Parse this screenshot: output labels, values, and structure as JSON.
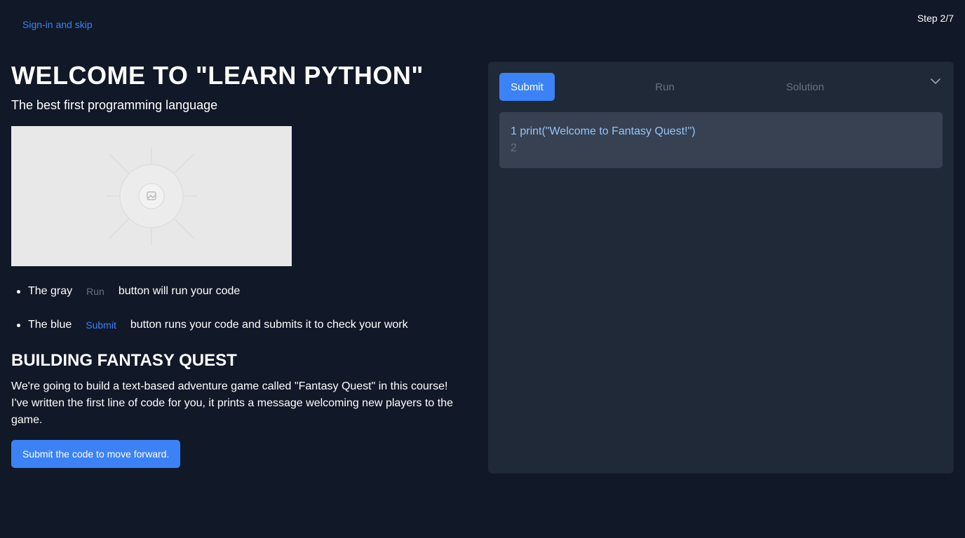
{
  "header": {
    "skip_link": "Sign-in and skip",
    "step": "Step 2/7"
  },
  "lesson": {
    "title": "WELCOME TO \"LEARN PYTHON\"",
    "subtitle": "The best first programming language",
    "bullets": [
      {
        "before": "The gray",
        "chip": "Run",
        "after": "button will run your code"
      },
      {
        "before": "The blue",
        "chip": "Submit",
        "after": "button runs your code and submits it to check your work"
      }
    ],
    "section_title": "BUILDING FANTASY QUEST",
    "paragraph": "We're going to build a text-based adventure game called \"Fantasy Quest\" in this course! I've written the first line of code for you, it prints a message welcoming new players to the game.",
    "cta": "Submit the code to move forward."
  },
  "editor_panel": {
    "submit_label": "Submit",
    "run_label": "Run",
    "solution_label": "Solution",
    "chevron_icon": "chevron-down-icon",
    "code_lines": [
      "1 print(\"Welcome to Fantasy Quest!\")",
      "2"
    ]
  },
  "colors": {
    "background": "#111827",
    "panel": "#1f2937",
    "editor": "#374151",
    "accent": "#3b82f6",
    "muted": "#6b7280",
    "code": "#93c5fd"
  }
}
